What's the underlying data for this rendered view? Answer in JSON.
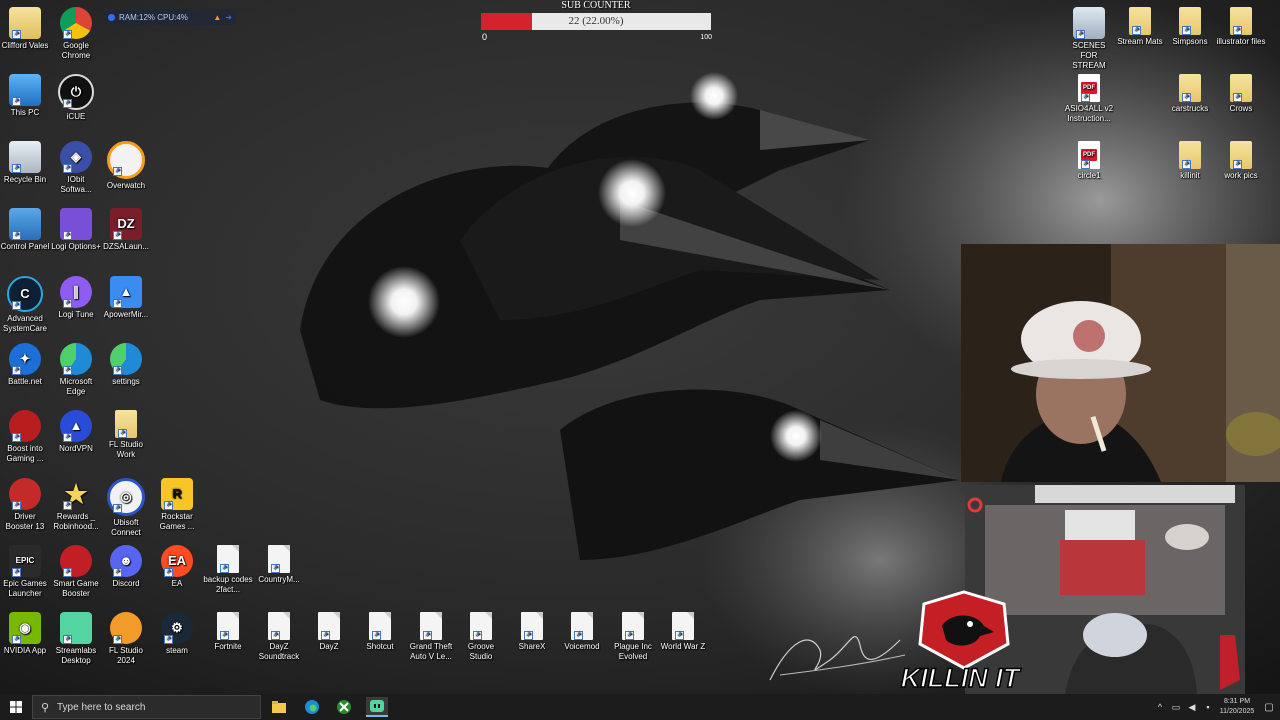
{
  "sub_counter": {
    "title": "SUB COUNTER",
    "value_text": "22 (22.00%)",
    "progress_fraction": 0.22,
    "min_label": "0",
    "max_label": "100"
  },
  "system_monitor": {
    "text": "RAM:12%  CPU:4%"
  },
  "desktop_icons_left": [
    {
      "label": "Clifford Vales",
      "icon": "user-folder-icon"
    },
    {
      "label": "Google Chrome",
      "icon": "chrome-icon"
    },
    {
      "label": "This PC",
      "icon": "this-pc-icon"
    },
    {
      "label": "iCUE",
      "icon": "icue-icon"
    },
    {
      "label": "Recycle Bin",
      "icon": "recycle-bin-icon"
    },
    {
      "label": "IObit Softwa...",
      "icon": "iobit-icon"
    },
    {
      "label": "Overwatch",
      "icon": "overwatch-icon"
    },
    {
      "label": "Control Panel",
      "icon": "control-panel-icon"
    },
    {
      "label": "Logi Options+",
      "icon": "logi-options-icon"
    },
    {
      "label": "DZSALaun...",
      "icon": "dzsa-icon"
    },
    {
      "label": "Advanced SystemCare",
      "icon": "advanced-systemcare-icon"
    },
    {
      "label": "Logi Tune",
      "icon": "logi-tune-icon"
    },
    {
      "label": "ApowerMir...",
      "icon": "apowermirror-icon"
    },
    {
      "label": "Battle.net",
      "icon": "battlenet-icon"
    },
    {
      "label": "Microsoft Edge",
      "icon": "edge-icon"
    },
    {
      "label": "settings",
      "icon": "edge-settings-icon"
    },
    {
      "label": "Boost into Gaming ...",
      "icon": "boost-icon"
    },
    {
      "label": "NordVPN",
      "icon": "nordvpn-icon"
    },
    {
      "label": "FL Studio Work",
      "icon": "folder-icon"
    },
    {
      "label": "Driver Booster 13",
      "icon": "driver-booster-icon"
    },
    {
      "label": "Rewards _ Robinhood...",
      "icon": "rewards-star-icon"
    },
    {
      "label": "Ubisoft Connect",
      "icon": "ubisoft-icon"
    },
    {
      "label": "Rockstar Games ...",
      "icon": "rockstar-icon"
    },
    {
      "label": "Epic Games Launcher",
      "icon": "epic-games-icon"
    },
    {
      "label": "Smart Game Booster",
      "icon": "smart-game-booster-icon"
    },
    {
      "label": "Discord",
      "icon": "discord-icon"
    },
    {
      "label": "EA",
      "icon": "ea-icon"
    },
    {
      "label": "backup codes 2fact...",
      "icon": "text-file-icon"
    },
    {
      "label": "CountryM...",
      "icon": "text-file-icon"
    },
    {
      "label": "NVIDIA App",
      "icon": "nvidia-icon"
    },
    {
      "label": "Streamlabs Desktop",
      "icon": "streamlabs-icon"
    },
    {
      "label": "FL Studio 2024",
      "icon": "fl-studio-icon"
    },
    {
      "label": "steam",
      "icon": "steam-icon"
    },
    {
      "label": "Fortnite",
      "icon": "text-file-icon"
    },
    {
      "label": "DayZ Soundtrack",
      "icon": "text-file-icon"
    },
    {
      "label": "DayZ",
      "icon": "text-file-icon"
    },
    {
      "label": "Shotcut",
      "icon": "text-file-icon"
    },
    {
      "label": "Grand Theft Auto V Le...",
      "icon": "text-file-icon"
    },
    {
      "label": "Groove Studio",
      "icon": "text-file-icon"
    },
    {
      "label": "ShareX",
      "icon": "text-file-icon"
    },
    {
      "label": "Voicemod",
      "icon": "text-file-icon"
    },
    {
      "label": "Plague Inc Evolved",
      "icon": "text-file-icon"
    },
    {
      "label": "World War Z",
      "icon": "text-file-icon"
    }
  ],
  "desktop_icons_right": [
    {
      "label": "SCENES FOR STREAM",
      "icon": "scenes-folder-icon"
    },
    {
      "label": "Stream Mats",
      "icon": "folder-icon"
    },
    {
      "label": "Simpsons",
      "icon": "folder-icon"
    },
    {
      "label": "illustrator files",
      "icon": "folder-icon"
    },
    {
      "label": "ASIO4ALL v2 Instruction...",
      "icon": "pdf-icon",
      "badge": "PDF"
    },
    {
      "label": "carstrucks",
      "icon": "folder-icon"
    },
    {
      "label": "Crows",
      "icon": "folder-icon"
    },
    {
      "label": "circle1",
      "icon": "pdf-icon",
      "badge": "PDF"
    },
    {
      "label": "killinit",
      "icon": "folder-icon"
    },
    {
      "label": "work pics",
      "icon": "folder-icon"
    }
  ],
  "overlay": {
    "logo_text": "KILLIN IT"
  },
  "taskbar": {
    "search_placeholder": "Type here to search",
    "apps": [
      "file-explorer-icon",
      "edge-icon",
      "xbox-icon",
      "streamlabs-icon"
    ],
    "time": "8:31 PM",
    "date": "11/20/2025"
  },
  "colors": {
    "counter_fill": "#d4222e",
    "taskbar": "#1c1c1c",
    "accent": "#76b9ed"
  }
}
